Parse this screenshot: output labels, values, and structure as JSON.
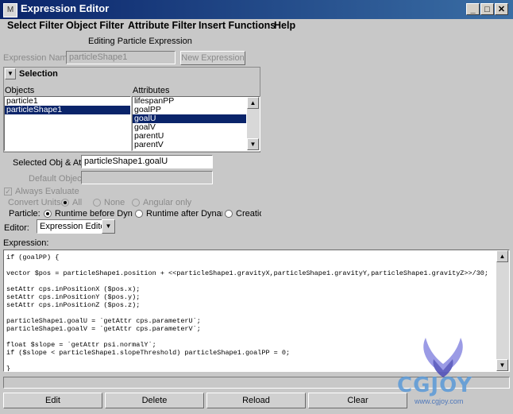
{
  "window": {
    "title": "Expression Editor",
    "logo": "M"
  },
  "menu": [
    "Select Filter",
    "Object Filter",
    "Attribute Filter",
    "Insert Functions",
    "Help"
  ],
  "header": {
    "editing_label": "Editing Particle Expression"
  },
  "expression_name": {
    "label": "Expression Name",
    "value": "particleShape1",
    "new_button": "New Expression"
  },
  "selection": {
    "title": "Selection",
    "objects_label": "Objects",
    "attributes_label": "Attributes",
    "objects": [
      "particle1",
      "particleShape1"
    ],
    "objects_selected": 1,
    "attributes": [
      "lifespanPP",
      "goalPP",
      "goalU",
      "goalV",
      "parentU",
      "parentV"
    ],
    "attributes_selected": 2
  },
  "selected_obj": {
    "label": "Selected Obj & Attr",
    "value": "particleShape1.goalU"
  },
  "default_object": {
    "label": "Default Object",
    "value": ""
  },
  "always_evaluate": {
    "label": "Always Evaluate"
  },
  "convert_units": {
    "label": "Convert Units:",
    "options": [
      "All",
      "None",
      "Angular only"
    ]
  },
  "particle": {
    "label": "Particle:",
    "options": [
      "Runtime before Dynamics",
      "Runtime after Dynamics",
      "Creation"
    ]
  },
  "editor": {
    "label": "Editor:",
    "value": "Expression Editor"
  },
  "expression": {
    "label": "Expression:",
    "lines": [
      "if (goalPP) {",
      "",
      "vector $pos = particleShape1.position + <<particleShape1.gravityX,particleShape1.gravityY,particleShape1.gravityZ>>/30;",
      "",
      "setAttr cps.inPositionX ($pos.x);",
      "setAttr cps.inPositionY ($pos.y);",
      "setAttr cps.inPositionZ ($pos.z);",
      "",
      "particleShape1.goalU = `getAttr cps.parameterU`;",
      "particleShape1.goalV = `getAttr cps.parameterV`;",
      "",
      "float $slope = `getAttr psi.normalY`;",
      "if ($slope < particleShape1.slopeThreshold) particleShape1.goalPP = 0;",
      "",
      "}"
    ]
  },
  "buttons": {
    "edit": "Edit",
    "delete": "Delete",
    "reload": "Reload",
    "clear": "Clear"
  },
  "watermark": {
    "text": "CGJOY",
    "sub": "www.cgjoy.com"
  }
}
